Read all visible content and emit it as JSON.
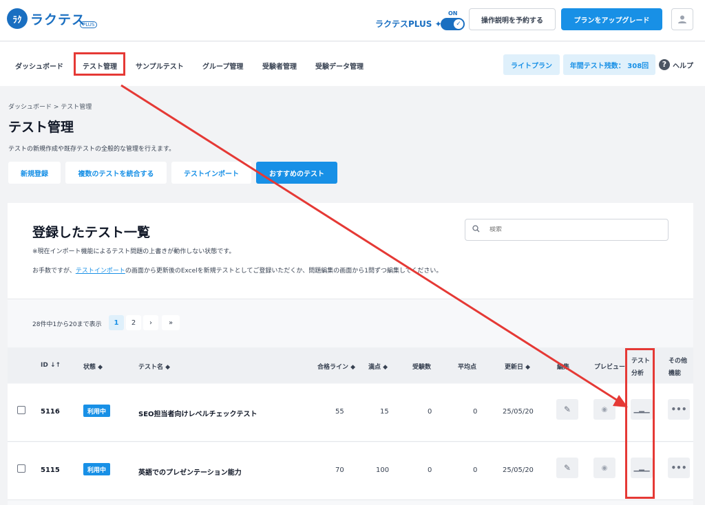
{
  "header": {
    "logo_mark": "ﾗｸ",
    "logo_text": "ラクテス",
    "logo_badge": "PLUS",
    "plus_label": "ラクテスPLUS ✦",
    "on_label": "ON",
    "reserve_button": "操作説明を予約する",
    "upgrade_button": "プランをアップグレード"
  },
  "nav": {
    "items": [
      "ダッシュボード",
      "テスト管理",
      "サンプルテスト",
      "グループ管理",
      "受験者管理",
      "受験データ管理"
    ],
    "plan_pill": "ライトプラン",
    "remaining_pill": "年間テスト残数： 308回",
    "help": "ヘルプ"
  },
  "page": {
    "breadcrumb": "ダッシュボード > テスト管理",
    "title": "テスト管理",
    "description": "テストの新規作成や既存テストの全般的な管理を行えます。",
    "actions": [
      "新規登録",
      "複数のテストを統合する",
      "テストインポート",
      "おすすめのテスト"
    ]
  },
  "list": {
    "title": "登録したテスト一覧",
    "note1": "※現在インポート機能によるテスト問題の上書きが動作しない状態です。",
    "note2_pre": "お手数ですが、",
    "note2_link": "テストインポート",
    "note2_post": "の画面から更新後のExcelを新規テストとしてご登録いただくか、問題編集の画面から1問ずつ編集してください。",
    "search_placeholder": "検索",
    "count": "28件中1から20まで表示",
    "pages": [
      "1",
      "2",
      "›",
      "»"
    ]
  },
  "table": {
    "headers": {
      "id": "ID ↓↑",
      "status": "状態 ◆",
      "name": "テスト名 ◆",
      "pass": "合格ライン ◆",
      "full": "満点 ◆",
      "takers": "受験数",
      "avg": "平均点",
      "updated": "更新日 ◆",
      "edit": "編集",
      "preview": "プレビュー",
      "analysis_1": "テスト",
      "analysis_2": "分析",
      "other_1": "その他",
      "other_2": "機能"
    },
    "rows": [
      {
        "id": "5116",
        "status": "利用中",
        "name": "SEO担当者向けレベルチェックテスト",
        "pass": "55",
        "full": "15",
        "takers": "0",
        "avg": "0",
        "updated": "25/05/20"
      },
      {
        "id": "5115",
        "status": "利用中",
        "name": "英語でのプレゼンテーション能力",
        "pass": "70",
        "full": "100",
        "takers": "0",
        "avg": "0",
        "updated": "25/05/20"
      }
    ]
  }
}
